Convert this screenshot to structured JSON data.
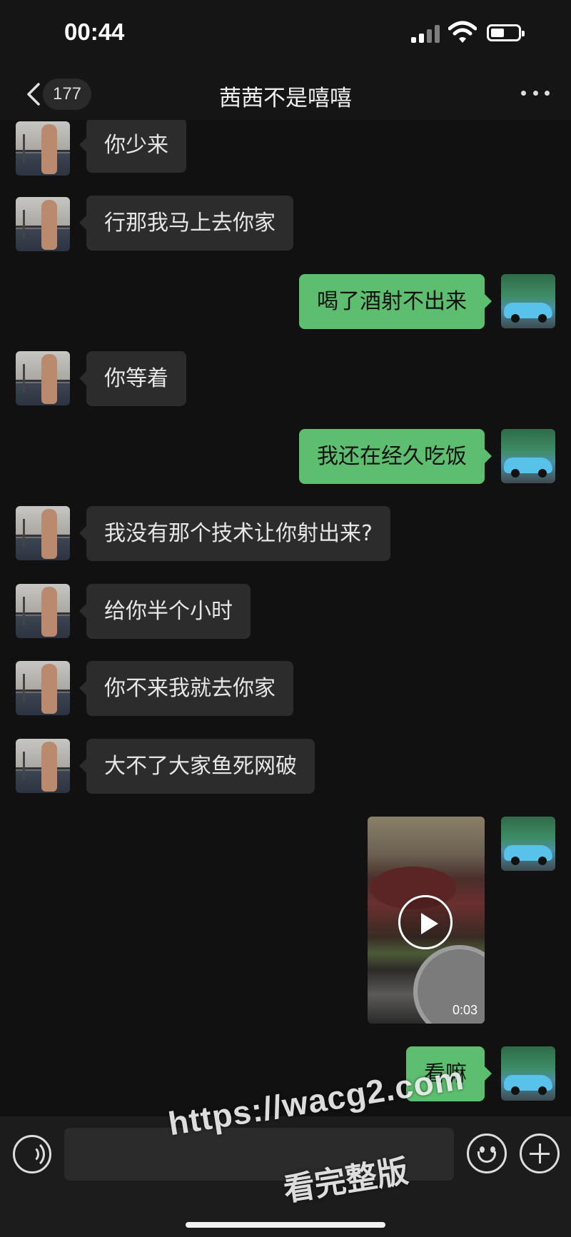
{
  "status_bar": {
    "time": "00:44"
  },
  "nav": {
    "unread_count": "177",
    "title": "茜茜不是嘻嘻"
  },
  "messages": [
    {
      "sender": "contact",
      "text": "你少来"
    },
    {
      "sender": "contact",
      "text": "行那我马上去你家"
    },
    {
      "sender": "me",
      "text": "喝了酒射不出来"
    },
    {
      "sender": "contact",
      "text": "你等着"
    },
    {
      "sender": "me",
      "text": "我还在经久吃饭"
    },
    {
      "sender": "contact",
      "text": "我没有那个技术让你射出来?"
    },
    {
      "sender": "contact",
      "text": "给你半个小时"
    },
    {
      "sender": "contact",
      "text": "你不来我就去你家"
    },
    {
      "sender": "contact",
      "text": "大不了大家鱼死网破"
    },
    {
      "sender": "me",
      "type": "video",
      "duration": "0:03"
    },
    {
      "sender": "me",
      "text": "看嘛"
    }
  ],
  "input": {
    "placeholder": ""
  },
  "watermark": {
    "url": "https://wacg2.com",
    "text": "看完整版"
  },
  "colors": {
    "background": "#111111",
    "incoming_bubble": "#2c2c2c",
    "outgoing_bubble": "#5dbe6f"
  }
}
